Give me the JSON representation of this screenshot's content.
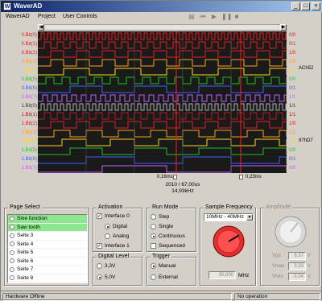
{
  "window": {
    "title": "WaverAD",
    "app_icon": "waverad-icon"
  },
  "menu": [
    "WaverAD",
    "Project",
    "User Controls"
  ],
  "toolbar": [
    "save-icon",
    "go-back-icon",
    "play-icon",
    "pause-icon",
    "stop-icon"
  ],
  "channels": [
    {
      "label": "0.Bit(0)",
      "value": "0/0",
      "color": "#e02020"
    },
    {
      "label": "0.Bit(1)",
      "value": "0/1",
      "color": "#e02020"
    },
    {
      "label": "0.Bit(2)",
      "value": "1/0",
      "color": "#e02020"
    },
    {
      "label": "0.Bit(3)",
      "value": "1/0",
      "color": "#ffa020"
    },
    {
      "label": "0.Bit(4)",
      "value": "1/1",
      "color": "#ffd820"
    },
    {
      "label": "0.Bit(5)",
      "value": "0/0",
      "color": "#20c020"
    },
    {
      "label": "0.Bit(6)",
      "value": "0/1",
      "color": "#4060ff"
    },
    {
      "label": "0.Bit(7)",
      "value": "1/1",
      "color": "#c060ff"
    },
    {
      "label": "1.Bit(0)",
      "value": "1/1",
      "color": "#b0b0b0"
    },
    {
      "label": "1.Bit(1)",
      "value": "1/1",
      "color": "#b02020"
    },
    {
      "label": "1.Bit(2)",
      "value": "1/0",
      "color": "#e02020"
    },
    {
      "label": "1.Bit(3)",
      "value": "1/1",
      "color": "#ffa020"
    },
    {
      "label": "1.Bit(4)",
      "value": "0/0",
      "color": "#ffd820"
    },
    {
      "label": "1.Bit(5)",
      "value": "0/0",
      "color": "#20c020"
    },
    {
      "label": "1.Bit(6)",
      "value": "0/1",
      "color": "#4060ff"
    },
    {
      "label": "1.Bit(7)",
      "value": "0/0",
      "color": "#c060ff"
    }
  ],
  "side_labels": {
    "top": "ACh52",
    "bottom": "97hD7"
  },
  "markers": {
    "left": "0,16ms",
    "right": "0,23ms",
    "range": "2010 / 67,00us",
    "freq": "14,93kHz"
  },
  "page_select": {
    "title": "Page Select",
    "items": [
      "Sine function",
      "Saw tooth",
      "Seite 3",
      "Seite 4",
      "Seite 5",
      "Seite 6",
      "Seite 7",
      "Seite 8"
    ],
    "selected": [
      0,
      1
    ]
  },
  "activation": {
    "title": "Activation",
    "interface0": "Interface 0",
    "digital": "Digital",
    "analog": "Analog",
    "interface1": "Interface 1"
  },
  "digital_level": {
    "title": "Digital Level",
    "v33": "3,3V",
    "v50": "5,0V"
  },
  "run_mode": {
    "title": "Run Mode",
    "step": "Step",
    "single": "Single",
    "continuous": "Continuous",
    "sequenced": "Sequenced"
  },
  "trigger": {
    "title": "Trigger",
    "manual": "Manual",
    "external": "External"
  },
  "sample_frequency": {
    "title": "Sample Frequency",
    "value": "10MHz - 40MHz",
    "freq_value": "30,000",
    "unit": "MHz",
    "knob_position": 0.72
  },
  "amplitude": {
    "title": "Amplitude",
    "vpp_label": "Vpp",
    "vpp": "6,37",
    "vmax_label": "Vmax",
    "vmax": "3,33",
    "vmin_label": "Vmin",
    "vmin": "-3,04",
    "unit": "V"
  },
  "status": {
    "left": "Hardware Offline",
    "right": "No operation"
  }
}
